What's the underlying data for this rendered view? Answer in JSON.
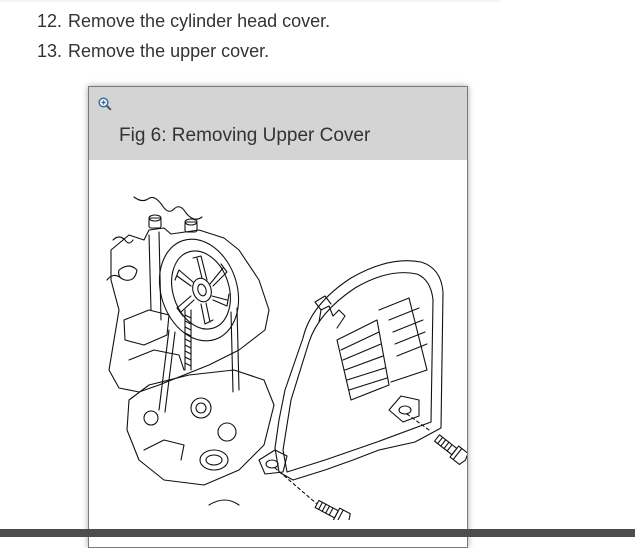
{
  "steps": [
    {
      "number": "12.",
      "text": "Remove the cylinder head cover."
    },
    {
      "number": "13.",
      "text": "Remove the upper cover."
    }
  ],
  "figure": {
    "title": "Fig 6: Removing Upper Cover",
    "zoom_icon": "zoom-in-icon",
    "illustration": "engine-upper-timing-cover-exploded-view"
  },
  "colors": {
    "header_bg": "#d4d4d4",
    "text": "#333333",
    "footer_bar": "#4d4d4d"
  }
}
